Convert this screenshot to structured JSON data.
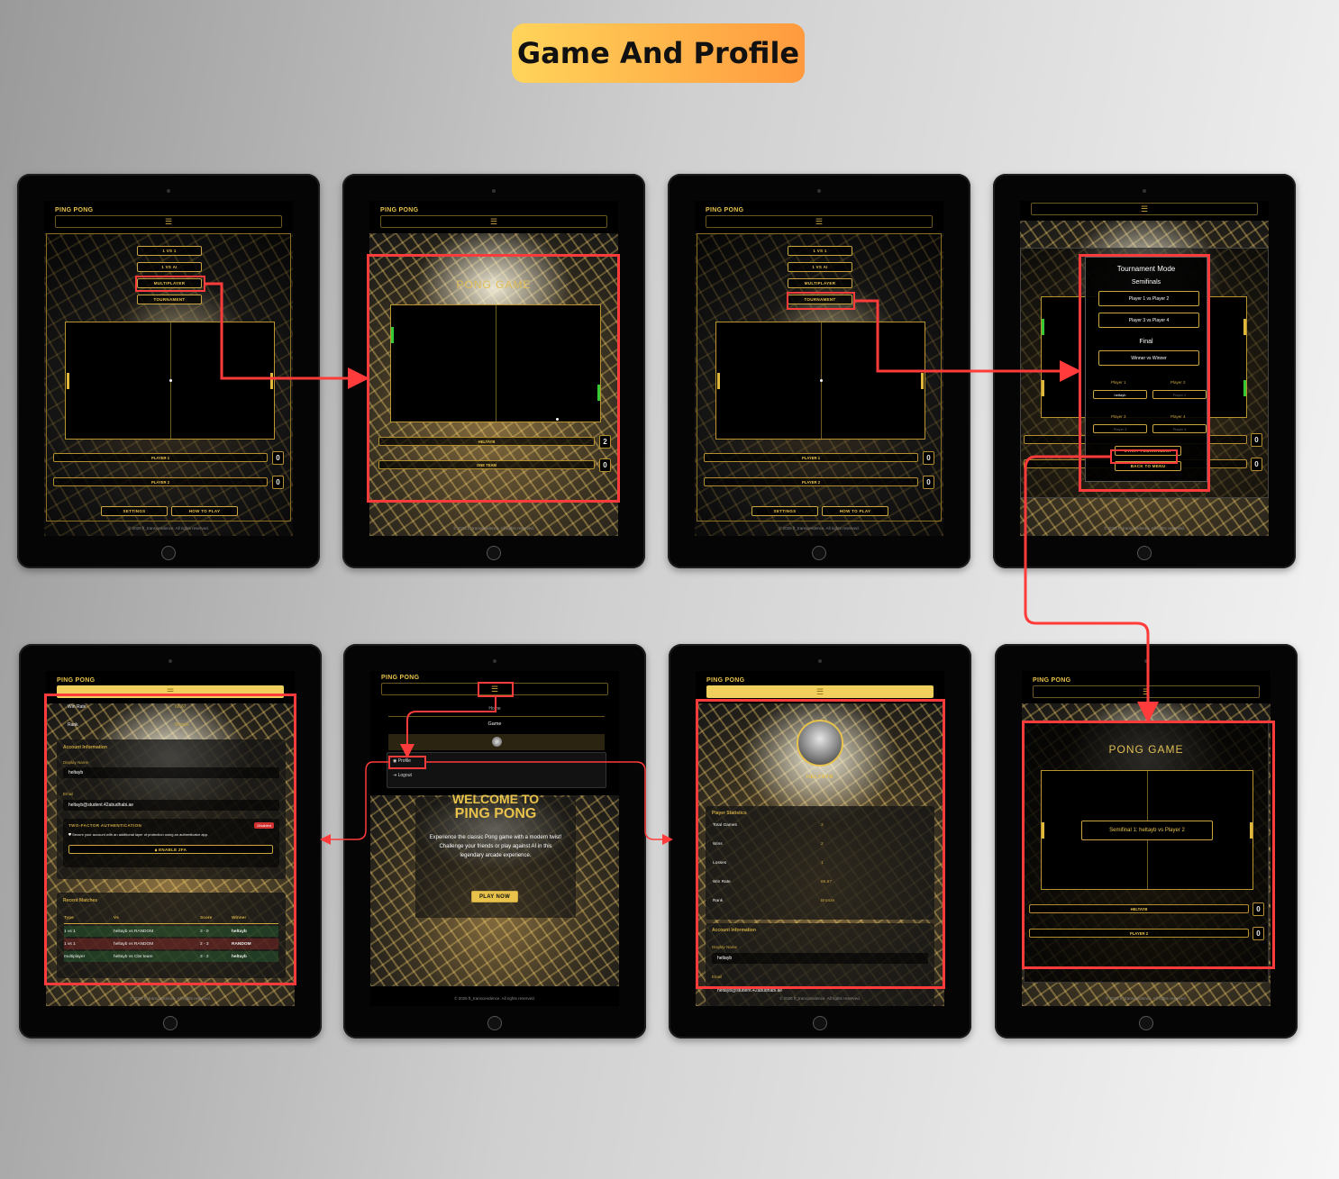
{
  "page_title": "Game And Profile",
  "app": {
    "brand": "PING PONG",
    "menu_icon": "hamburger-icon",
    "footer": "© 2025 ft_transcendence. All rights reserved."
  },
  "game_menu": {
    "modes": [
      "1 VS 1",
      "1 VS AI",
      "MULTIPLAYER",
      "TOURNAMENT"
    ],
    "player1": "PLAYER 1",
    "player2": "PLAYER 2",
    "score1": "0",
    "score2": "0",
    "settings": "SETTINGS",
    "how_to_play": "HOW TO PLAY"
  },
  "multiplayer_game": {
    "title": "PONG GAME",
    "team1": "HELTAYB",
    "team1_score": "2",
    "team2": "ONE TEAM",
    "team2_score": "0"
  },
  "tournament_modal": {
    "title": "Tournament Mode",
    "semifinals": "Semifinals",
    "match1": "Player 1 vs Player 2",
    "match2": "Player 3 vs Player 4",
    "final": "Final",
    "final_match": "Winner vs Winner",
    "p1_label": "Player 1",
    "p2_label": "Player 2",
    "p3_label": "Player 3",
    "p4_label": "Player 4",
    "p1_value": "heltayb",
    "p2_placeholder": "Player 2",
    "p3_placeholder": "Player 3",
    "p4_placeholder": "Player 4",
    "start": "START TOURNAMENT",
    "back": "BACK TO MENU"
  },
  "settings_page": {
    "win_rate_label": "Win Rate",
    "win_rate_value": "66.67",
    "rank_label": "Rank",
    "rank_value": "Bronze",
    "account_title": "Account Information",
    "display_name_label": "Display Name",
    "display_name": "heltayb",
    "email_label": "Email",
    "email": "heltayb@student.42abudhabi.ae",
    "tfa_title": "TWO-FACTOR AUTHENTICATION",
    "tfa_status": "Disabled",
    "tfa_desc": "Secure your account with an additional layer of protection using an authenticator app.",
    "tfa_button": "ENABLE 2FA",
    "recent_title": "Recent Matches",
    "matches_headers": [
      "Type",
      "Vs",
      "Score",
      "Winner"
    ],
    "matches": [
      [
        "1 vs 1",
        "heltayb vs RANDOM",
        "3 - 0",
        "heltayb"
      ],
      [
        "1 vs 1",
        "heltayb vs RANDOM",
        "2 - 3",
        "RANDOM"
      ],
      [
        "multiplayer",
        "heltayb vs Cbs team",
        "3 - 2",
        "heltayb"
      ]
    ]
  },
  "home_page": {
    "nav_home": "Home",
    "nav_game": "Game",
    "dropdown_profile": "Profile",
    "dropdown_logout": "Logout",
    "welcome_line1": "WELCOME TO",
    "welcome_line2": "PING PONG",
    "description": "Experience the classic Pong game with a modern twist! Challenge your friends or play against AI in this legendary arcade experience.",
    "play_now": "PLAY NOW"
  },
  "profile_page": {
    "username": "HELTAYB",
    "stats_title": "Player Statistics",
    "stats": [
      [
        "Total Games",
        "3"
      ],
      [
        "Wins",
        "2"
      ],
      [
        "Losses",
        "1"
      ],
      [
        "Win Rate",
        "66.67"
      ],
      [
        "Rank",
        "Bronze"
      ]
    ],
    "account_title": "Account Information",
    "display_name_label": "Display Name",
    "display_name": "heltayb",
    "email_label": "Email",
    "email": "heltayb@student.42abudhabi.ae"
  },
  "tournament_game": {
    "title": "PONG GAME",
    "announcement": "Semifinal 1: heltayb vs Player 2",
    "player1": "HELTAYB",
    "player2": "PLAYER 2",
    "score1": "0",
    "score2": "0"
  },
  "colors": {
    "gold": "#e8c24a",
    "highlight": "#ff3b3b",
    "paddle_green": "#35c935"
  }
}
